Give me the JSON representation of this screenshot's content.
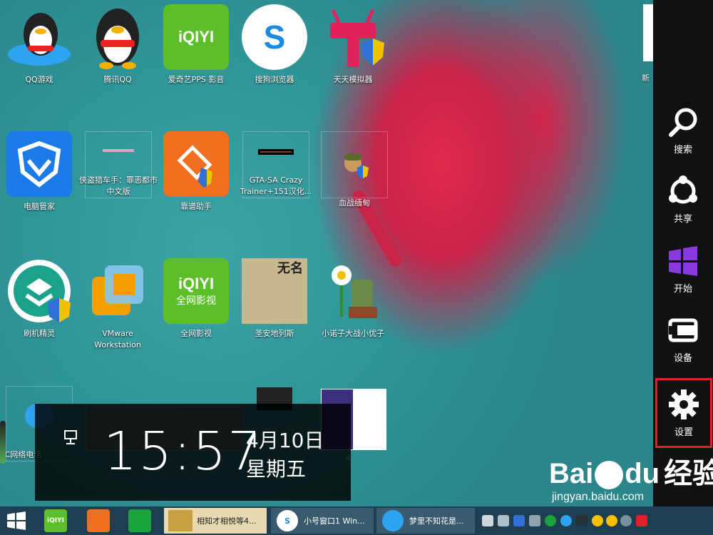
{
  "desktop": {
    "icons": [
      {
        "label": "QQ游戏",
        "icon": "qq-game-icon"
      },
      {
        "label": "腾讯QQ",
        "icon": "qq-penguin-icon"
      },
      {
        "label": "爱奇艺PPS 影音",
        "icon": "iqiyi-pps-icon",
        "text": "iQIYI"
      },
      {
        "label": "搜狗浏览器",
        "icon": "sogou-browser-icon",
        "text": "S"
      },
      {
        "label": "天天模拟器",
        "icon": "tiantian-emulator-icon"
      },
      {
        "label": "新",
        "icon": "document-icon"
      },
      {
        "label": "电脑管家",
        "icon": "tencent-pc-manager-icon"
      },
      {
        "label": "侠盗猎车手：罪恶都市 中文版",
        "icon": "gta-vice-city-icon"
      },
      {
        "label": "靠谱助手",
        "icon": "kaopu-assistant-icon"
      },
      {
        "label": "GTA-SA Crazy Trainer+151汉化...",
        "icon": "gta-sa-trainer-icon"
      },
      {
        "label": "血战缅甸",
        "icon": "soldier-game-icon"
      },
      {
        "label": "刷机精灵",
        "icon": "shuaji-jingling-icon"
      },
      {
        "label": "VMware Workstation",
        "icon": "vmware-icon"
      },
      {
        "label": "全网影视",
        "icon": "iqiyi-video-icon",
        "text": "iQIYI",
        "subtext": "全网影视"
      },
      {
        "label": "圣安地列斯",
        "icon": "san-andreas-icon",
        "text": "无名"
      },
      {
        "label": "小诺子大战小优子",
        "icon": "plants-zombies-icon"
      },
      {
        "label": "KC网络电话",
        "icon": "kc-phone-icon"
      },
      {
        "label": "4",
        "icon": "document-icon"
      }
    ]
  },
  "charms": [
    {
      "label": "搜索",
      "icon": "search-icon"
    },
    {
      "label": "共享",
      "icon": "share-icon"
    },
    {
      "label": "开始",
      "icon": "windows-start-icon"
    },
    {
      "label": "设备",
      "icon": "devices-icon"
    },
    {
      "label": "设置",
      "icon": "gear-icon",
      "highlighted": true
    }
  ],
  "clock": {
    "time": "15:57",
    "date": "4月10日",
    "weekday": "星期五",
    "network_icon": "network-icon"
  },
  "taskbar": {
    "pinned": [
      {
        "name": "start",
        "icon": "windows-logo-icon"
      },
      {
        "name": "iqiyi",
        "icon": "iqiyi-icon",
        "text": "iQIYI"
      },
      {
        "name": "kaopu",
        "icon": "kaopu-icon"
      },
      {
        "name": "store",
        "icon": "store-icon"
      }
    ],
    "windows": [
      {
        "label": "相知才相悦等4...",
        "icon": "folder-thumbnail-icon"
      },
      {
        "label": "小号窗口1 Win...",
        "icon": "sogou-browser-icon"
      },
      {
        "label": "梦里不知花是...",
        "icon": "qq-chat-icon"
      }
    ],
    "tray_icons": [
      "flag-icon",
      "volume-icon",
      "shield-icon",
      "display-icon",
      "sync-icon",
      "qq-icon",
      "qq-icon",
      "speaker-icon",
      "qq-icon",
      "qq-icon",
      "close-icon",
      "sogou-icon"
    ]
  },
  "watermark": {
    "brand": "Bai",
    "brand2": "du",
    "brand_cn": "经验",
    "url": "jingyan.baidu.com"
  },
  "colors": {
    "charm_bg": "#111111",
    "highlight": "#e0202a",
    "taskbar": "#1e3e52",
    "windows_purple": "#8a3be0"
  }
}
